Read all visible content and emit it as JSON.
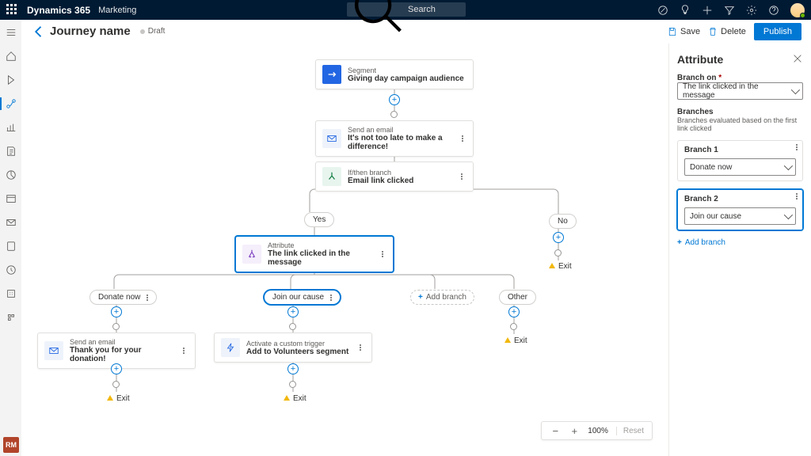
{
  "topbar": {
    "brand": "Dynamics 365",
    "sub": "Marketing",
    "search_ph": "Search"
  },
  "header": {
    "journey_name": "Journey name",
    "status": "Draft",
    "save": "Save",
    "delete": "Delete",
    "publish": "Publish"
  },
  "nodes": {
    "audience": {
      "label": "Segment",
      "name": "Giving day campaign audience"
    },
    "email1": {
      "label": "Send an email",
      "name": "It's not too late to make a difference!"
    },
    "ifthen": {
      "label": "If/then branch",
      "name": "Email link clicked"
    },
    "yes": "Yes",
    "no": "No",
    "attribute": {
      "label": "Attribute",
      "name": "The link clicked in the message"
    },
    "branch1_pill": "Donate now",
    "branch2_pill": "Join our cause",
    "addbranch_node": "Add branch",
    "other_pill": "Other",
    "email2": {
      "label": "Send an email",
      "name": "Thank you for your donation!"
    },
    "trigger": {
      "label": "Activate a custom trigger",
      "name": "Add to Volunteers segment"
    },
    "exit": "Exit"
  },
  "zoom": {
    "value": "100%",
    "reset": "Reset"
  },
  "panel": {
    "title": "Attribute",
    "branch_on_label": "Branch on",
    "branch_on_value": "The link clicked in the message",
    "branches_title": "Branches",
    "branches_sub": "Branches evaluated based on the first link clicked",
    "b1_label": "Branch 1",
    "b1_value": "Donate now",
    "b2_label": "Branch 2",
    "b2_value": "Join our cause",
    "add_branch": "Add branch"
  },
  "rm": "RM"
}
